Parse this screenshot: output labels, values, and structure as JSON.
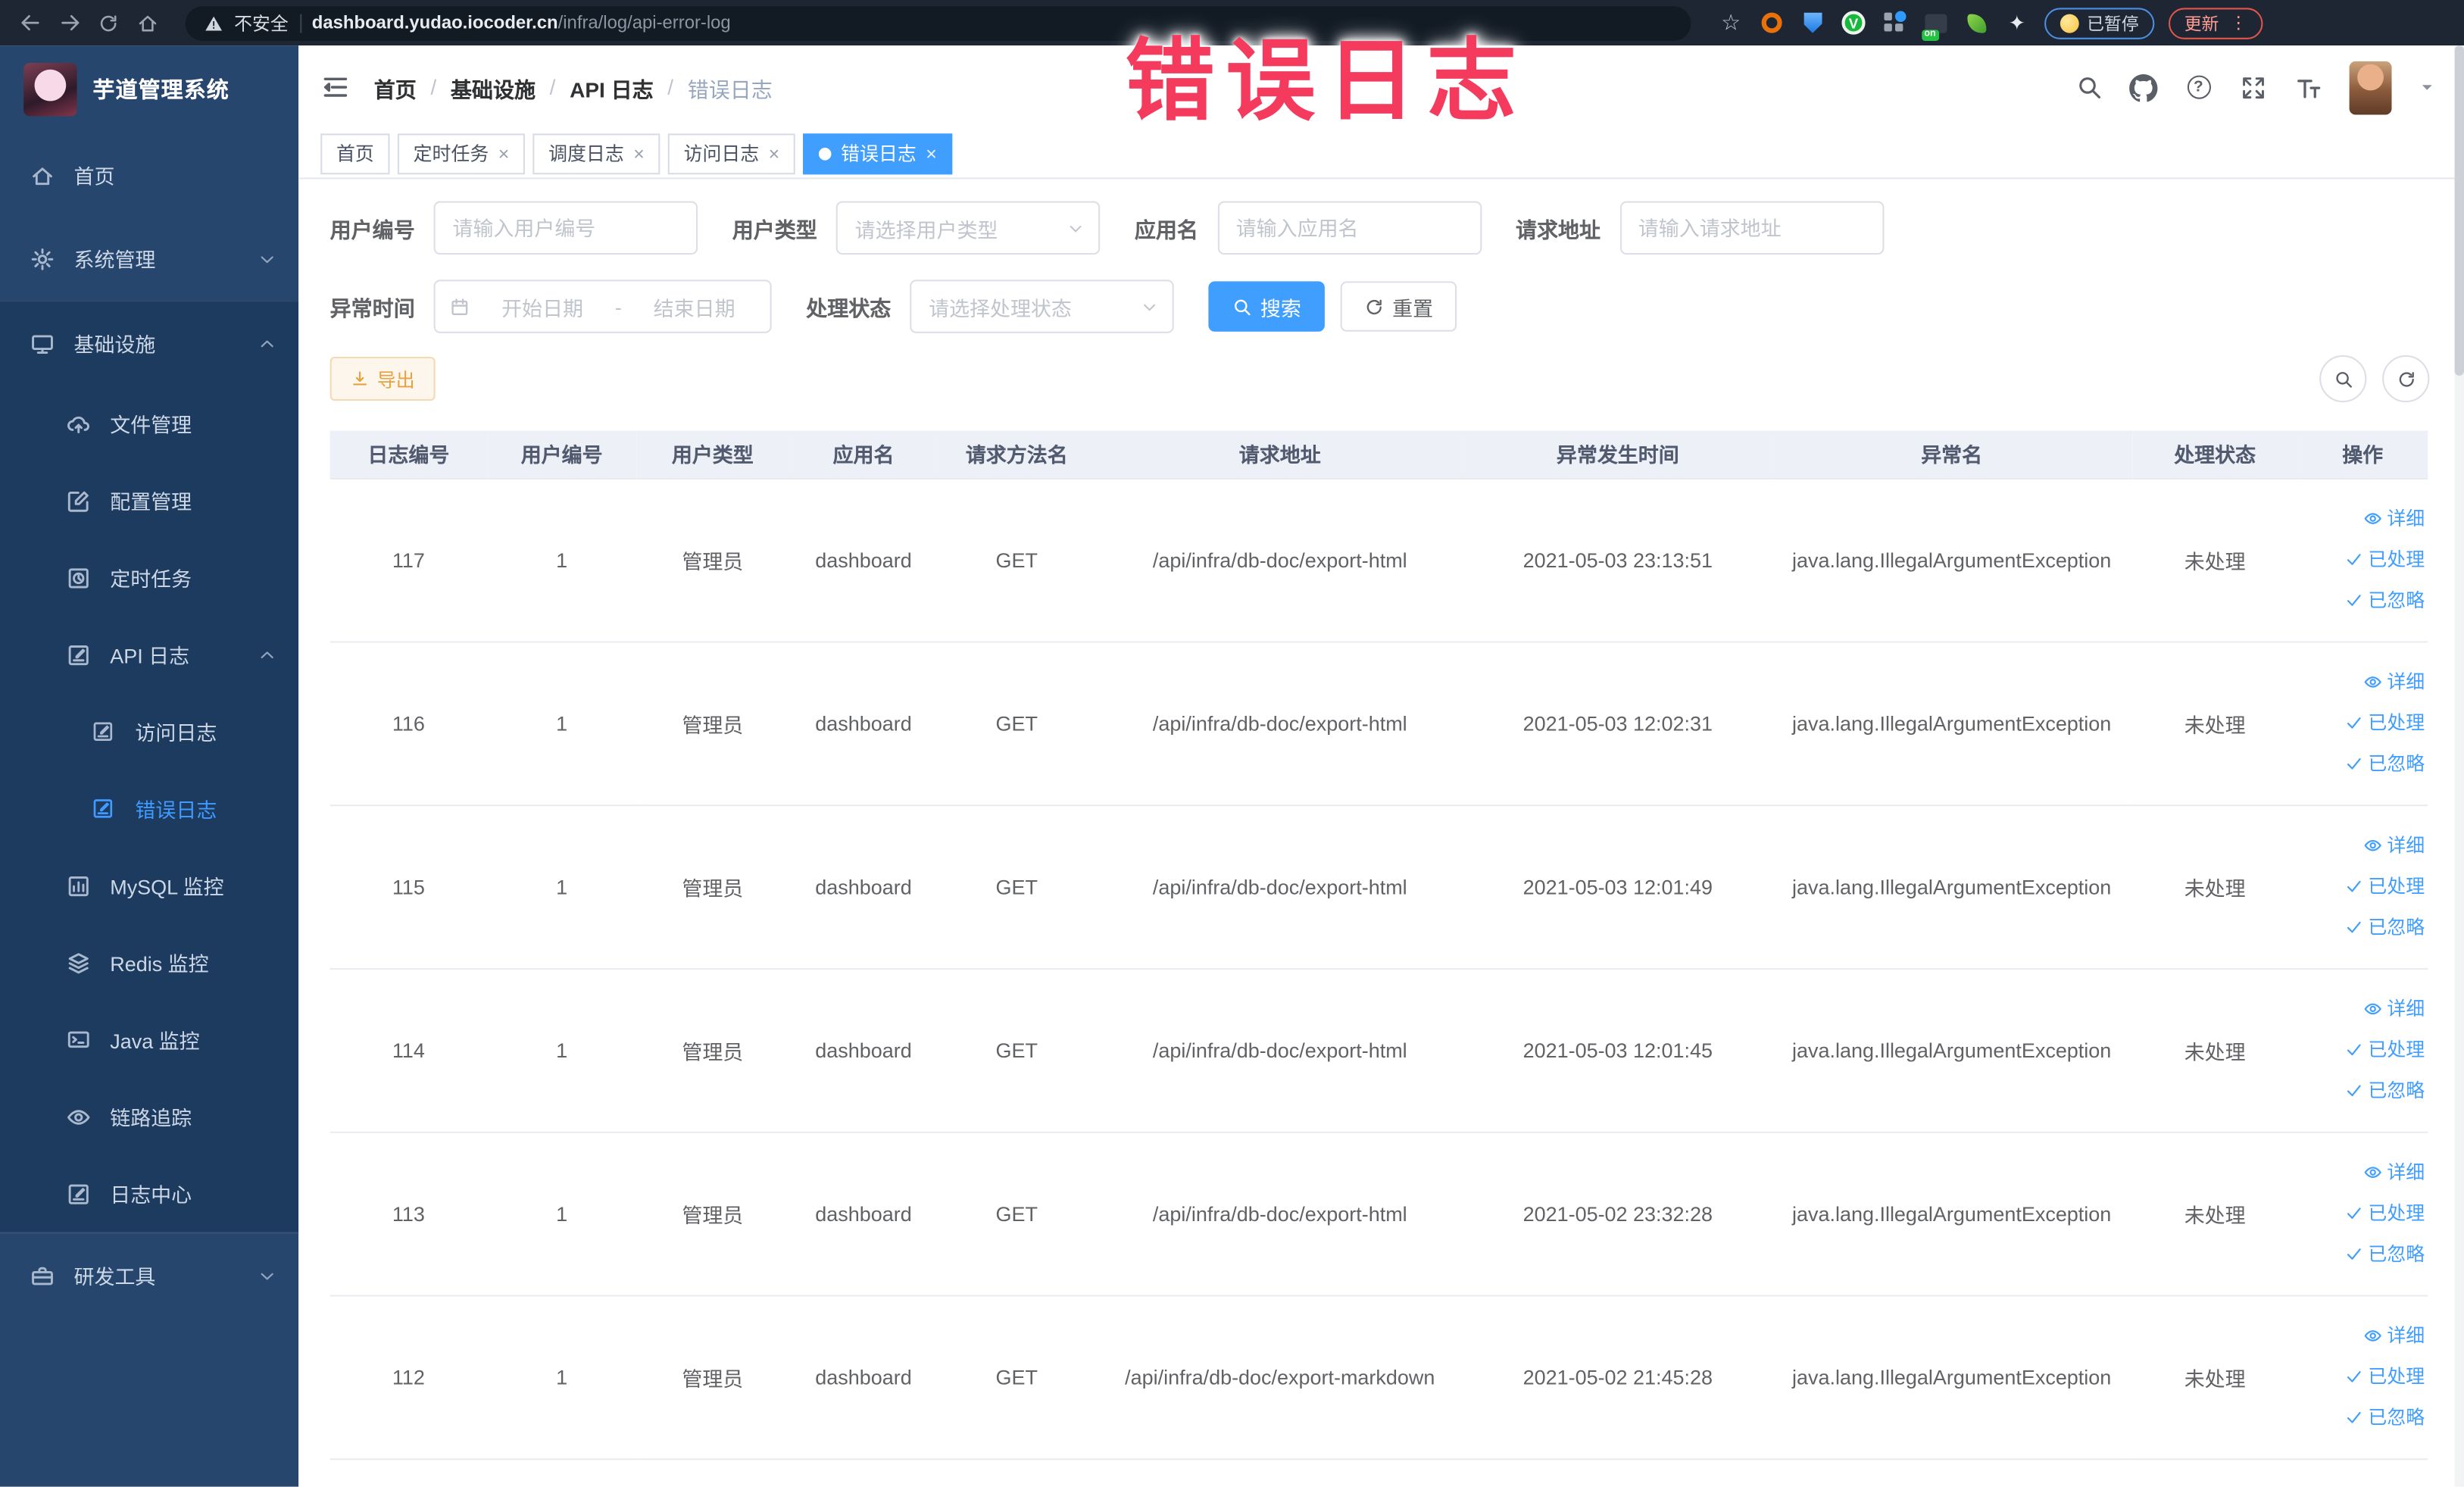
{
  "browser": {
    "security_label": "不安全",
    "url_host": "dashboard.yudao.iocoder.cn",
    "url_path": "/infra/log/api-error-log",
    "paused_badge": "已暂停",
    "update_button": "更新"
  },
  "annotation": {
    "text": "错误日志",
    "color": "#f43b5e"
  },
  "sidebar": {
    "logo_title": "芋道管理系统",
    "items": [
      {
        "label": "首页"
      },
      {
        "label": "系统管理",
        "expanded": false
      },
      {
        "label": "基础设施",
        "expanded": true
      },
      {
        "label": "文件管理"
      },
      {
        "label": "配置管理"
      },
      {
        "label": "定时任务"
      },
      {
        "label": "API 日志",
        "expanded": true
      },
      {
        "label": "访问日志"
      },
      {
        "label": "错误日志",
        "active": true
      },
      {
        "label": "MySQL 监控"
      },
      {
        "label": "Redis 监控"
      },
      {
        "label": "Java 监控"
      },
      {
        "label": "链路追踪"
      },
      {
        "label": "日志中心"
      },
      {
        "label": "研发工具",
        "expanded": false
      }
    ]
  },
  "breadcrumb": {
    "items": [
      "首页",
      "基础设施",
      "API 日志",
      "错误日志"
    ]
  },
  "tabs": [
    {
      "label": "首页",
      "closable": false,
      "active": false
    },
    {
      "label": "定时任务",
      "closable": true,
      "active": false
    },
    {
      "label": "调度日志",
      "closable": true,
      "active": false
    },
    {
      "label": "访问日志",
      "closable": true,
      "active": false
    },
    {
      "label": "错误日志",
      "closable": true,
      "active": true
    }
  ],
  "filters": {
    "user_id": {
      "label": "用户编号",
      "placeholder": "请输入用户编号",
      "value": ""
    },
    "user_type": {
      "label": "用户类型",
      "placeholder": "请选择用户类型"
    },
    "app_name": {
      "label": "应用名",
      "placeholder": "请输入应用名",
      "value": ""
    },
    "request_url": {
      "label": "请求地址",
      "placeholder": "请输入请求地址",
      "value": ""
    },
    "exception_time": {
      "label": "异常时间",
      "start_placeholder": "开始日期",
      "separator": "-",
      "end_placeholder": "结束日期"
    },
    "process_status": {
      "label": "处理状态",
      "placeholder": "请选择处理状态"
    },
    "search_button": "搜索",
    "reset_button": "重置"
  },
  "toolbar": {
    "export_button": "导出"
  },
  "table": {
    "columns": [
      "日志编号",
      "用户编号",
      "用户类型",
      "应用名",
      "请求方法名",
      "请求地址",
      "异常发生时间",
      "异常名",
      "处理状态",
      "操作"
    ],
    "action_labels": {
      "detail": "详细",
      "processed": "已处理",
      "ignored": "已忽略"
    },
    "rows": [
      {
        "id": "117",
        "user_id": "1",
        "user_type": "管理员",
        "app": "dashboard",
        "method": "GET",
        "url": "/api/infra/db-doc/export-html",
        "time": "2021-05-03 23:13:51",
        "exception": "java.lang.IllegalArgumentException",
        "status": "未处理"
      },
      {
        "id": "116",
        "user_id": "1",
        "user_type": "管理员",
        "app": "dashboard",
        "method": "GET",
        "url": "/api/infra/db-doc/export-html",
        "time": "2021-05-03 12:02:31",
        "exception": "java.lang.IllegalArgumentException",
        "status": "未处理"
      },
      {
        "id": "115",
        "user_id": "1",
        "user_type": "管理员",
        "app": "dashboard",
        "method": "GET",
        "url": "/api/infra/db-doc/export-html",
        "time": "2021-05-03 12:01:49",
        "exception": "java.lang.IllegalArgumentException",
        "status": "未处理"
      },
      {
        "id": "114",
        "user_id": "1",
        "user_type": "管理员",
        "app": "dashboard",
        "method": "GET",
        "url": "/api/infra/db-doc/export-html",
        "time": "2021-05-03 12:01:45",
        "exception": "java.lang.IllegalArgumentException",
        "status": "未处理"
      },
      {
        "id": "113",
        "user_id": "1",
        "user_type": "管理员",
        "app": "dashboard",
        "method": "GET",
        "url": "/api/infra/db-doc/export-html",
        "time": "2021-05-02 23:32:28",
        "exception": "java.lang.IllegalArgumentException",
        "status": "未处理"
      },
      {
        "id": "112",
        "user_id": "1",
        "user_type": "管理员",
        "app": "dashboard",
        "method": "GET",
        "url": "/api/infra/db-doc/export-markdown",
        "time": "2021-05-02 21:45:28",
        "exception": "java.lang.IllegalArgumentException",
        "status": "未处理"
      }
    ]
  },
  "colors": {
    "accent": "#409eff",
    "sidebar_bg": "#27466e",
    "sidebar_submenu_bg": "#1d3a5f",
    "warning": "#e6a23c",
    "annotation_red": "#f43b5e"
  }
}
